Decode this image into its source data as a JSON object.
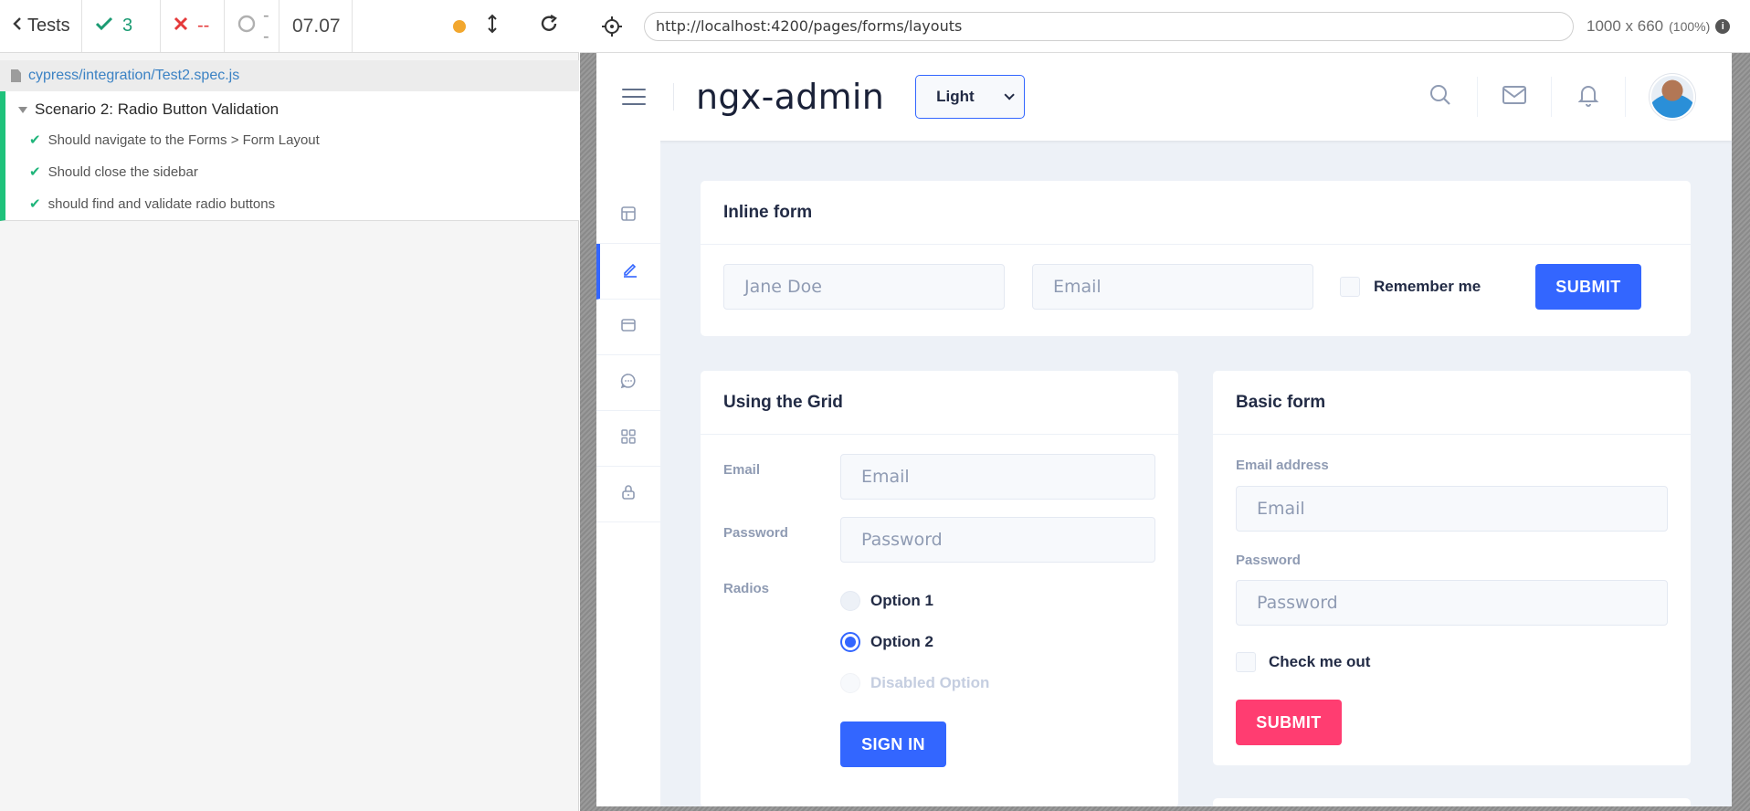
{
  "runner": {
    "back_label": "Tests",
    "passed": "3",
    "failed": "--",
    "pending": "--",
    "duration": "07.07",
    "spec_path": "cypress/integration/Test2.spec.js",
    "suite_title": "Scenario 2: Radio Button Validation",
    "tests": [
      {
        "title": "Should navigate to the Forms > Form Layout",
        "status": "passed"
      },
      {
        "title": "Should close the sidebar",
        "status": "passed"
      },
      {
        "title": "should find and validate radio buttons",
        "status": "passed"
      }
    ]
  },
  "browser": {
    "url": "http://localhost:4200/pages/forms/layouts",
    "viewport": "1000 x 660",
    "scale": "(100%)"
  },
  "app": {
    "logo": "ngx-admin",
    "theme": "Light",
    "sidebar_icons": [
      "layout-icon",
      "edit-icon",
      "browser-icon",
      "message-icon",
      "grid-icon",
      "lock-icon"
    ],
    "inline_form": {
      "title": "Inline form",
      "name_placeholder": "Jane Doe",
      "email_placeholder": "Email",
      "remember_label": "Remember me",
      "submit_label": "SUBMIT"
    },
    "grid_form": {
      "title": "Using the Grid",
      "email_label": "Email",
      "email_placeholder": "Email",
      "password_label": "Password",
      "password_placeholder": "Password",
      "radios_label": "Radios",
      "options": [
        "Option 1",
        "Option 2",
        "Disabled Option"
      ],
      "selected_option": "Option 2",
      "signin_label": "SIGN IN"
    },
    "basic_form": {
      "title": "Basic form",
      "email_label": "Email address",
      "email_placeholder": "Email",
      "password_label": "Password",
      "password_placeholder": "Password",
      "check_label": "Check me out",
      "submit_label": "SUBMIT"
    }
  },
  "colors": {
    "primary": "#3366ff",
    "danger": "#ff3d71",
    "pass": "#1fc27b",
    "fail": "#e5393a"
  }
}
